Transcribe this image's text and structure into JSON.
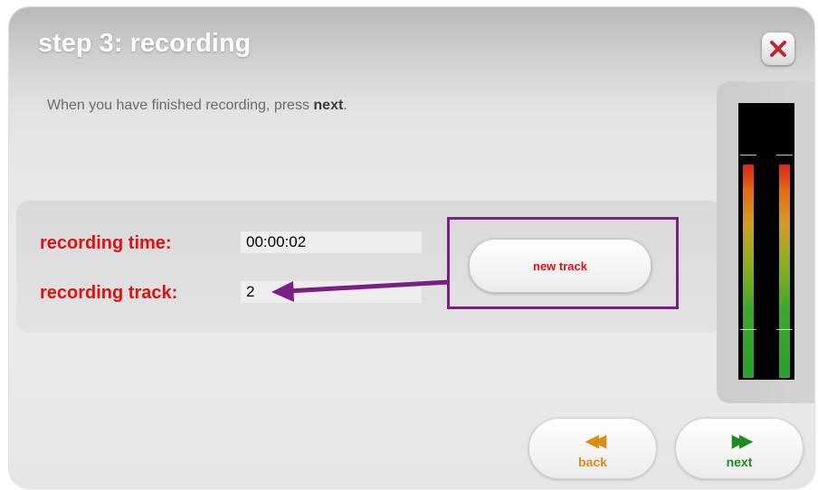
{
  "dialog": {
    "title": "step 3: recording",
    "close_icon": "close-x-icon",
    "close_icon_color": "#c0262d"
  },
  "instructions": {
    "prefix": "When you have finished recording, press ",
    "emphasis": "next",
    "suffix": "."
  },
  "fields": {
    "time_label": "recording time:",
    "time_value": "00:00:02",
    "track_label": "recording track:",
    "track_value": "2"
  },
  "actions": {
    "new_track_label": "new track",
    "back_label": "back",
    "back_icon": "rewind-icon",
    "next_label": "next",
    "next_icon": "fast-forward-icon"
  },
  "colors": {
    "label_red": "#e30f0f",
    "annotation_purple": "#7a1f86",
    "back_orange": "#d98c16",
    "next_green": "#1f8a1f"
  },
  "level_meter": {
    "channels": 2,
    "level_left": 0.88,
    "level_right": 0.88
  }
}
